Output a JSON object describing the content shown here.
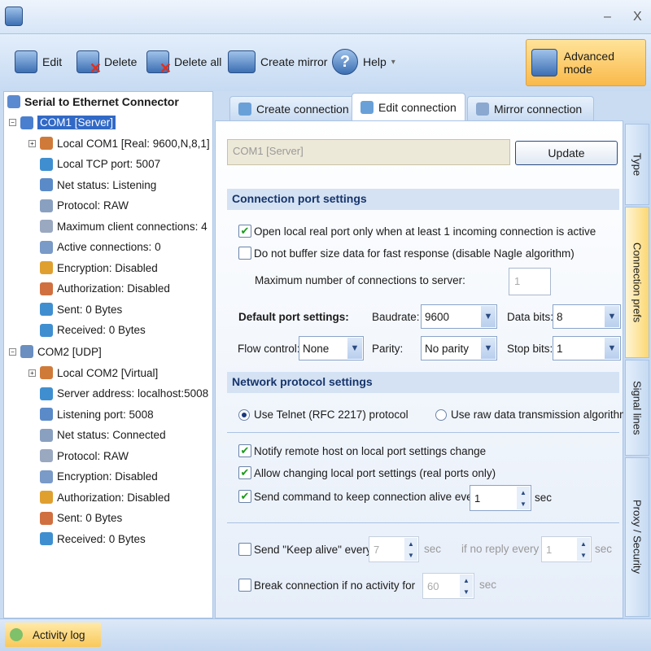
{
  "window": {
    "minimize": "–",
    "close": "X"
  },
  "toolbar": {
    "edit": "Edit",
    "delete": "Delete",
    "delete_all": "Delete all",
    "create_mirror": "Create mirror",
    "help": "Help",
    "help_arrow": "▾",
    "advanced_mode": "Advanced mode"
  },
  "tree": {
    "root": "Serial to Ethernet Connector",
    "com1": {
      "label": "COM1 [Server]",
      "children": [
        "Local COM1 [Real: 9600,N,8,1]",
        "Local TCP port: 5007",
        "Net status: Listening",
        "Protocol: RAW",
        "Maximum client connections: 4",
        "Active connections: 0",
        "Encryption: Disabled",
        "Authorization: Disabled",
        "Sent: 0 Bytes",
        "Received: 0 Bytes"
      ]
    },
    "com2": {
      "label": "COM2 [UDP]",
      "children": [
        "Local COM2 [Virtual]",
        "Server address: localhost:5008",
        "Listening port: 5008",
        "Net status: Connected",
        "Protocol: RAW",
        "Encryption: Disabled",
        "Authorization: Disabled",
        "Sent: 0 Bytes",
        "Received: 0 Bytes"
      ]
    }
  },
  "tabs": {
    "create": "Create connection",
    "edit": "Edit connection",
    "mirror": "Mirror connection"
  },
  "vtabs": [
    "Type",
    "Connection prefs",
    "Signal lines",
    "Proxy / Security"
  ],
  "form": {
    "name_value": "COM1 [Server]",
    "update": "Update",
    "section1": "Connection port settings",
    "open_local": "Open local real port only when at least 1 incoming connection is active",
    "no_buffer": "Do not buffer size data for fast response (disable Nagle algorithm)",
    "max_conn_label": "Maximum number of connections to server:",
    "max_conn_value": "1",
    "default_port": "Default port settings:",
    "baudrate_label": "Baudrate:",
    "baudrate": "9600",
    "databits_label": "Data bits:",
    "databits": "8",
    "flow_label": "Flow control:",
    "flow": "None",
    "parity_label": "Parity:",
    "parity": "No parity",
    "stopbits_label": "Stop bits:",
    "stopbits": "1",
    "section2": "Network protocol settings",
    "telnet": "Use Telnet (RFC 2217) protocol",
    "raw": "Use raw data transmission algorithms",
    "notify": "Notify remote host on local port settings change",
    "allow": "Allow changing local port settings (real ports only)",
    "keep_cmd": "Send command to keep connection alive every",
    "keep_cmd_value": "1",
    "sec": "sec",
    "keepalive": "Send \"Keep alive\" every",
    "keepalive_value": "7",
    "noreply": "if no reply every",
    "noreply_value": "1",
    "break": "Break connection if no activity for",
    "break_value": "60"
  },
  "status": {
    "activity_log": "Activity log"
  }
}
